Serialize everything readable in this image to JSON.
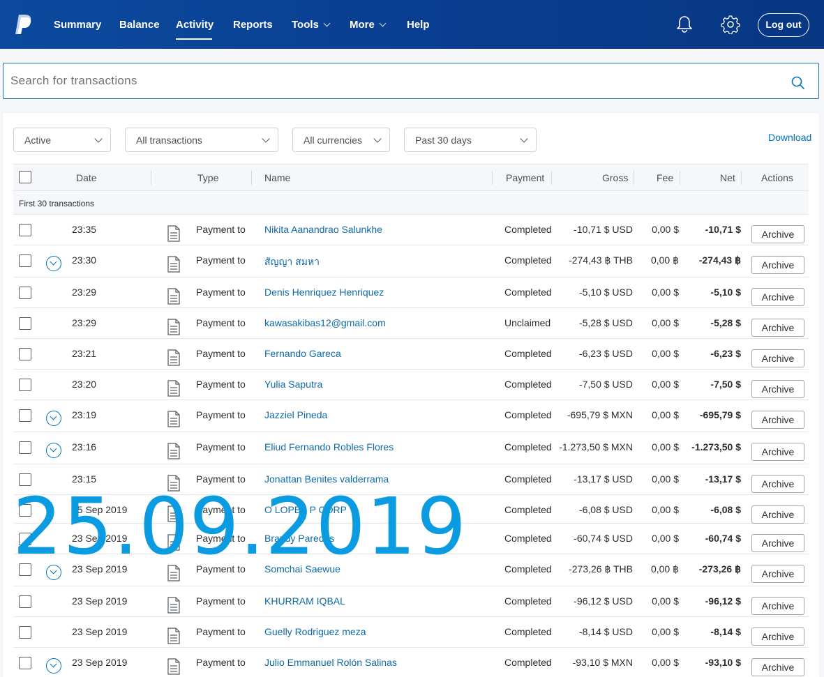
{
  "nav": {
    "items": [
      {
        "label": "Summary",
        "has_menu": false
      },
      {
        "label": "Balance",
        "has_menu": false
      },
      {
        "label": "Activity",
        "has_menu": false,
        "active": true
      },
      {
        "label": "Reports",
        "has_menu": false
      },
      {
        "label": "Tools",
        "has_menu": true
      },
      {
        "label": "More",
        "has_menu": true
      },
      {
        "label": "Help",
        "has_menu": false
      }
    ],
    "logout_label": "Log out",
    "icons": [
      "paypal-logo",
      "bell-icon",
      "gear-icon"
    ],
    "colors": {
      "bar": "#0a3d8f",
      "link": "#0070ba"
    }
  },
  "search": {
    "placeholder": "Search for transactions"
  },
  "filters": {
    "status": "Active",
    "type": "All transactions",
    "currency": "All currencies",
    "period": "Past 30 days",
    "download_label": "Download"
  },
  "table": {
    "headers": {
      "date": "Date",
      "type": "Type",
      "name": "Name",
      "payment": "Payment",
      "gross": "Gross",
      "fee": "Fee",
      "net": "Net",
      "actions": "Actions"
    },
    "subheading": "First 30 transactions",
    "archive_label": "Archive",
    "rows": [
      {
        "date": "23:35",
        "type": "Payment to",
        "name": "Nikita Aanandrao Salunkhe",
        "status": "Completed",
        "gross": "-10,71 $ USD",
        "fee": "0,00 $",
        "net": "-10,71 $",
        "expand": false
      },
      {
        "date": "23:30",
        "type": "Payment to",
        "name": "สัญญา สมหา",
        "status": "Completed",
        "gross": "-274,43 ฿ THB",
        "fee": "0,00 ฿",
        "net": "-274,43 ฿",
        "expand": true
      },
      {
        "date": "23:29",
        "type": "Payment to",
        "name": "Denis Henriquez Henriquez",
        "status": "Completed",
        "gross": "-5,10 $ USD",
        "fee": "0,00 $",
        "net": "-5,10 $",
        "expand": false
      },
      {
        "date": "23:29",
        "type": "Payment to",
        "name": "kawasakibas12@gmail.com",
        "status": "Unclaimed",
        "gross": "-5,28 $ USD",
        "fee": "0,00 $",
        "net": "-5,28 $",
        "expand": false
      },
      {
        "date": "23:21",
        "type": "Payment to",
        "name": "Fernando Gareca",
        "status": "Completed",
        "gross": "-6,23 $ USD",
        "fee": "0,00 $",
        "net": "-6,23 $",
        "expand": false
      },
      {
        "date": "23:20",
        "type": "Payment to",
        "name": "Yulia Saputra",
        "status": "Completed",
        "gross": "-7,50 $ USD",
        "fee": "0,00 $",
        "net": "-7,50 $",
        "expand": false
      },
      {
        "date": "23:19",
        "type": "Payment to",
        "name": "Jazziel Pineda",
        "status": "Completed",
        "gross": "-695,79 $ MXN",
        "fee": "0,00 $",
        "net": "-695,79 $",
        "expand": true
      },
      {
        "date": "23:16",
        "type": "Payment to",
        "name": "Eliud Fernando Robles Flores",
        "status": "Completed",
        "gross": "-1.273,50 $ MXN",
        "fee": "0,00 $",
        "net": "-1.273,50 $",
        "expand": true
      },
      {
        "date": "23:15",
        "type": "Payment to",
        "name": "Jonattan Benites valderrama",
        "status": "Completed",
        "gross": "-13,17 $ USD",
        "fee": "0,00 $",
        "net": "-13,17 $",
        "expand": false
      },
      {
        "date": "25 Sep 2019",
        "type": "Payment to",
        "name": "O LOPEZ P CORP",
        "status": "Completed",
        "gross": "-6,08 $ USD",
        "fee": "0,00 $",
        "net": "-6,08 $",
        "expand": false
      },
      {
        "date": "23 Sep 2019",
        "type": "Payment to",
        "name": "Brandy Paredes",
        "status": "Completed",
        "gross": "-60,74 $ USD",
        "fee": "0,00 $",
        "net": "-60,74 $",
        "expand": false
      },
      {
        "date": "23 Sep 2019",
        "type": "Payment to",
        "name": "Somchai Saewue",
        "status": "Completed",
        "gross": "-273,26 ฿ THB",
        "fee": "0,00 ฿",
        "net": "-273,26 ฿",
        "expand": true
      },
      {
        "date": "23 Sep 2019",
        "type": "Payment to",
        "name": "KHURRAM IQBAL",
        "status": "Completed",
        "gross": "-96,12 $ USD",
        "fee": "0,00 $",
        "net": "-96,12 $",
        "expand": false
      },
      {
        "date": "23 Sep 2019",
        "type": "Payment to",
        "name": "Guelly Rodriguez meza",
        "status": "Completed",
        "gross": "-8,14 $ USD",
        "fee": "0,00 $",
        "net": "-8,14 $",
        "expand": false
      },
      {
        "date": "23 Sep 2019",
        "type": "Payment to",
        "name": "Julio Emmanuel Rolón Salinas",
        "status": "Completed",
        "gross": "-93,10 $ MXN",
        "fee": "0,00 $",
        "net": "-93,10 $",
        "expand": true
      }
    ]
  },
  "overlay": {
    "text": "25.09.2019",
    "color": "#0b9be0"
  }
}
